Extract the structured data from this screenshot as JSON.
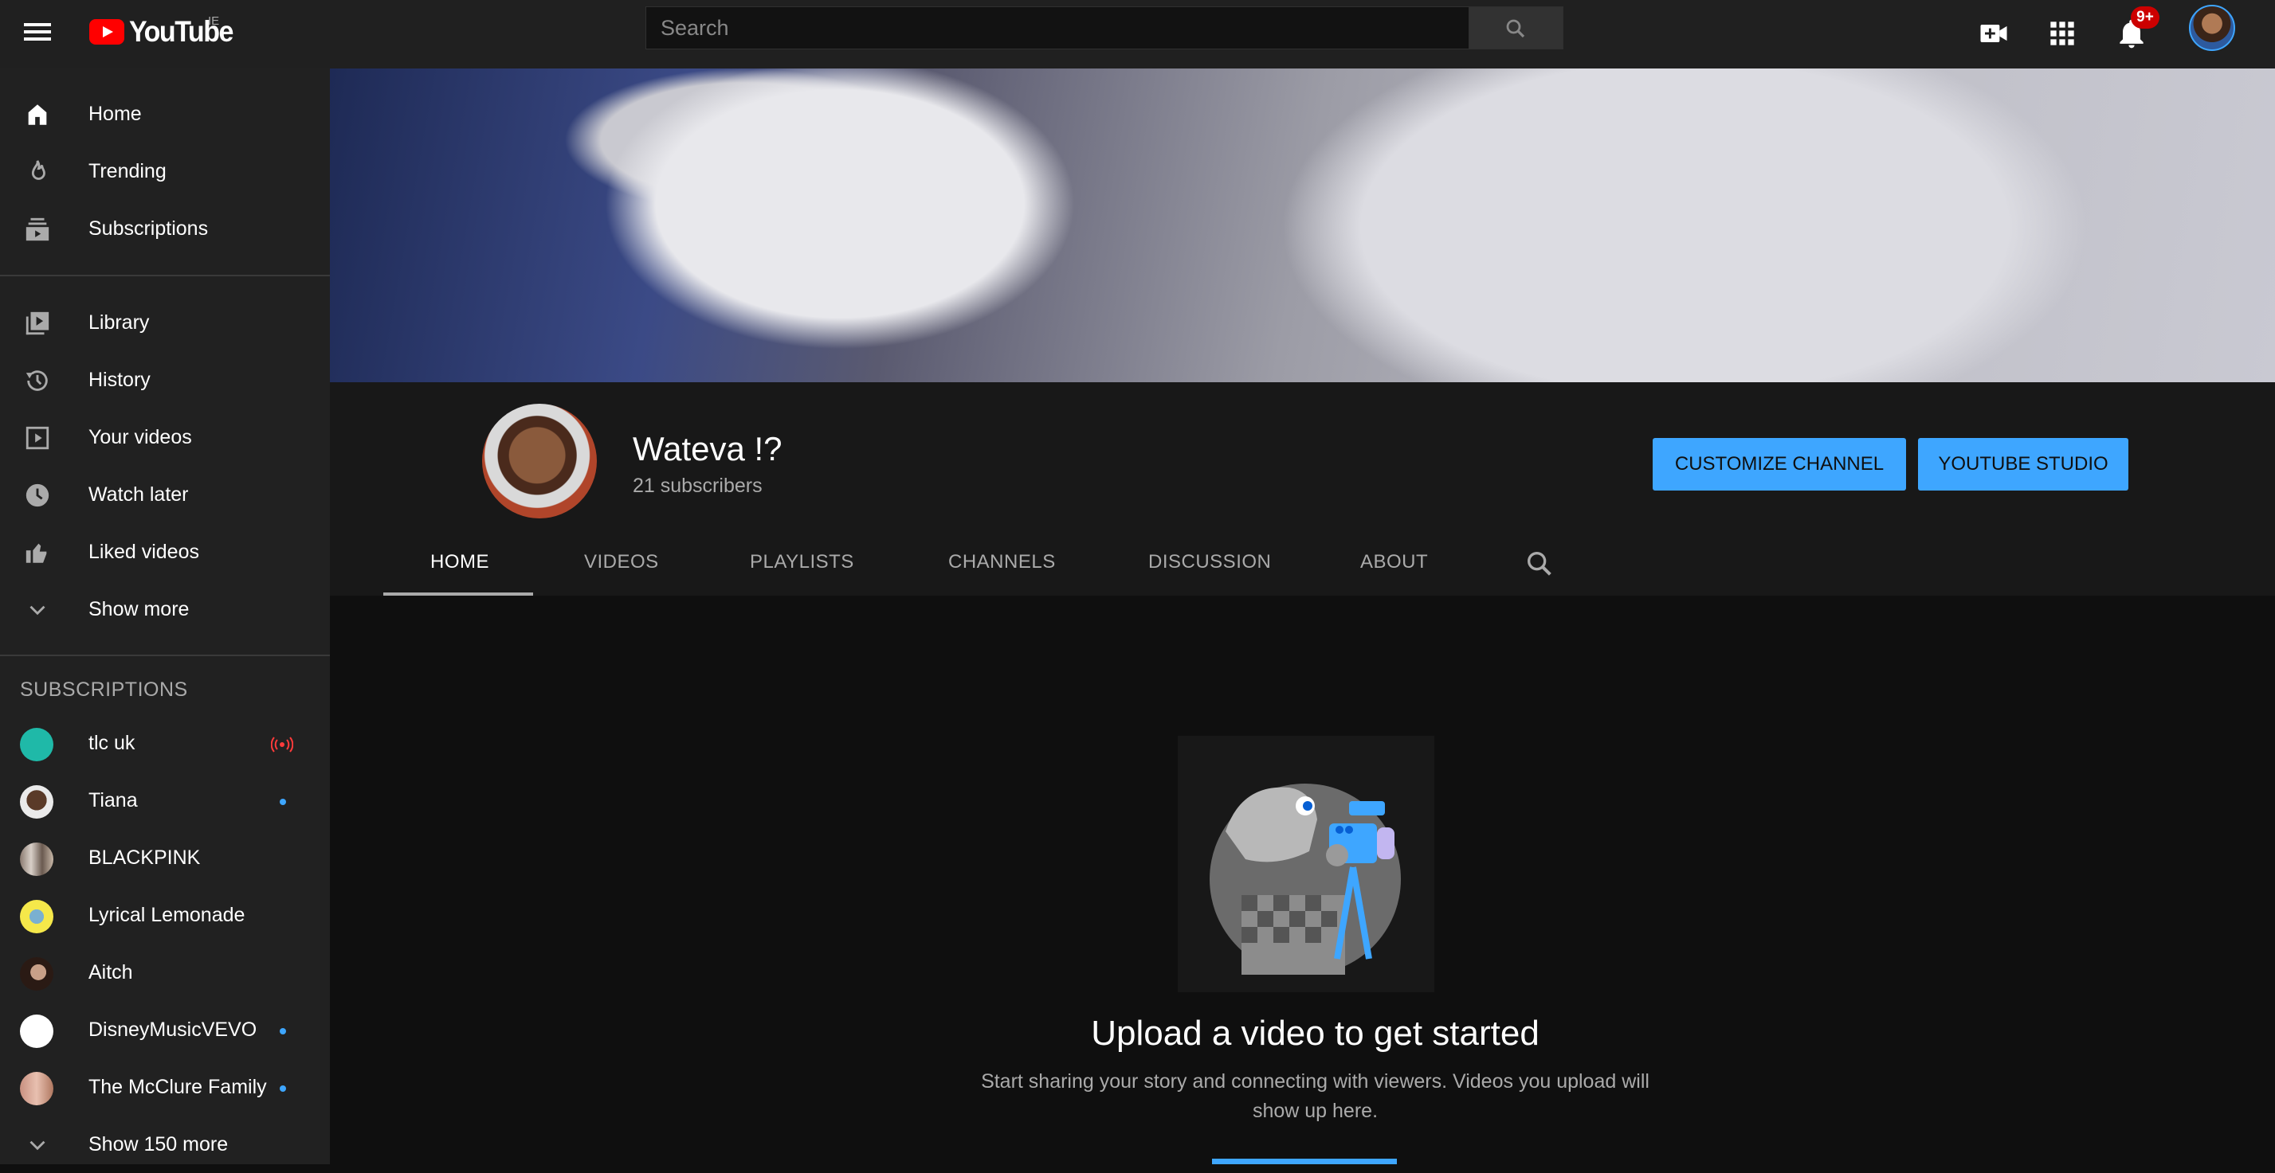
{
  "topbar": {
    "logo_text": "YouTube",
    "country_code": "IE",
    "search_placeholder": "Search",
    "notifications_badge": "9+",
    "icons": [
      "menu-icon",
      "create-video-icon",
      "apps-icon",
      "notifications-icon",
      "search-icon"
    ]
  },
  "sidebar": {
    "main_items": [
      {
        "label": "Home",
        "icon": "home-icon"
      },
      {
        "label": "Trending",
        "icon": "flame-icon"
      },
      {
        "label": "Subscriptions",
        "icon": "subscriptions-icon"
      }
    ],
    "library_items": [
      {
        "label": "Library",
        "icon": "library-icon"
      },
      {
        "label": "History",
        "icon": "history-icon"
      },
      {
        "label": "Your videos",
        "icon": "your-videos-icon"
      },
      {
        "label": "Watch later",
        "icon": "clock-icon"
      },
      {
        "label": "Liked videos",
        "icon": "thumbs-up-icon"
      },
      {
        "label": "Show more",
        "icon": "chevron-down-icon"
      }
    ],
    "subscriptions_heading": "SUBSCRIPTIONS",
    "subscriptions": [
      {
        "name": "tlc uk",
        "status": "live"
      },
      {
        "name": "Tiana",
        "status": "new"
      },
      {
        "name": "BLACKPINK",
        "status": ""
      },
      {
        "name": "Lyrical Lemonade",
        "status": ""
      },
      {
        "name": "Aitch",
        "status": ""
      },
      {
        "name": "DisneyMusicVEVO",
        "status": "new"
      },
      {
        "name": "The McClure Family",
        "status": "new"
      }
    ],
    "show_more_subs": "Show 150 more"
  },
  "channel": {
    "name": "Wateva !?",
    "subscribers": "21 subscribers",
    "customize_button": "CUSTOMIZE CHANNEL",
    "studio_button": "YOUTUBE STUDIO",
    "tabs": [
      "HOME",
      "VIDEOS",
      "PLAYLISTS",
      "CHANNELS",
      "DISCUSSION",
      "ABOUT"
    ],
    "active_tab": "HOME"
  },
  "empty_state": {
    "title": "Upload a video to get started",
    "text": "Start sharing your story and connecting with viewers. Videos you upload will show up here."
  },
  "colors": {
    "accent_blue": "#3ea6ff",
    "brand_red": "#ff0000",
    "live_red": "#cc0000",
    "sidebar_bg": "#212121",
    "topbar_bg": "#202020"
  }
}
